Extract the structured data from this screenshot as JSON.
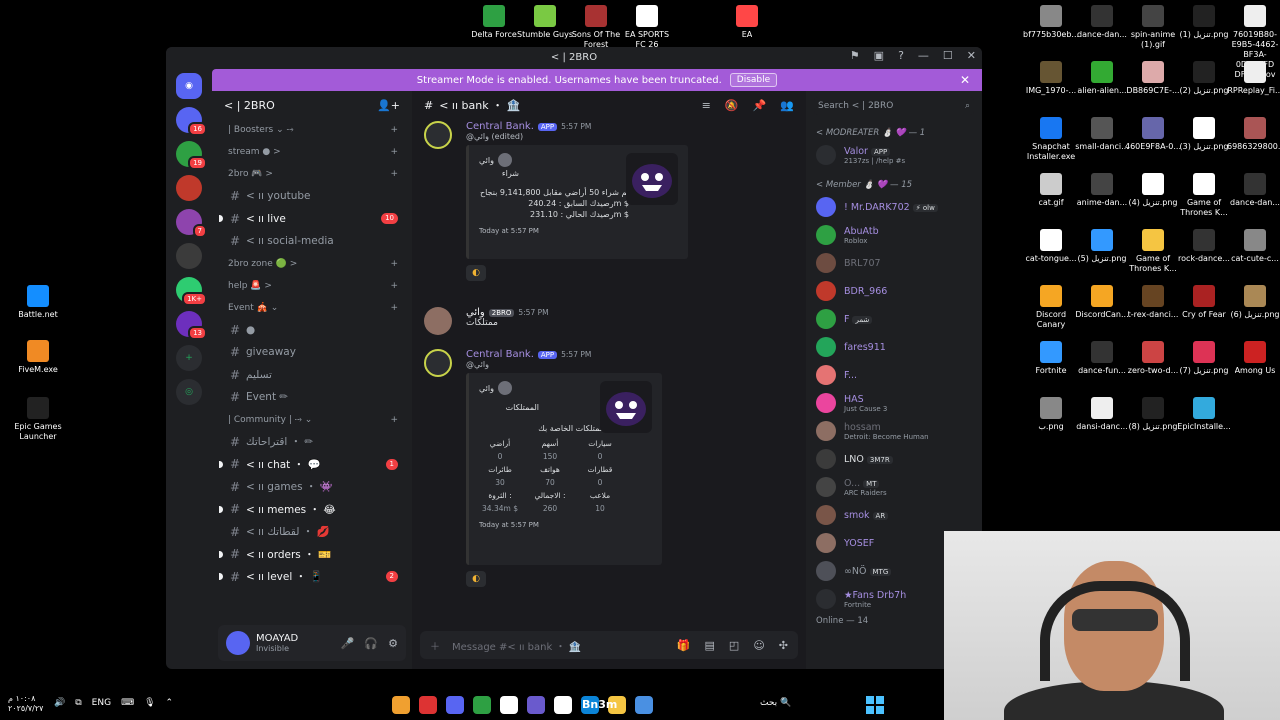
{
  "desktop": {
    "top_icons": [
      {
        "label": "Delta Force",
        "color": "#2ea043"
      },
      {
        "label": "Stumble Guys",
        "color": "#7ac943"
      },
      {
        "label": "Sons Of The Forest",
        "color": "#a83232"
      },
      {
        "label": "EA SPORTS FC 26",
        "color": "#ffffff"
      },
      {
        "label": "EA",
        "color": "#ff4747"
      }
    ],
    "left_icons": [
      {
        "label": "Battle.net",
        "color": "#148eff"
      },
      {
        "label": "FiveM.exe",
        "color": "#f08a24"
      },
      {
        "label": "Epic Games Launcher",
        "color": "#222222"
      }
    ],
    "right_icons": [
      {
        "label": "bf775b30eb...",
        "color": "#888888"
      },
      {
        "label": "dance-dan...",
        "color": "#333333"
      },
      {
        "label": "spin-anime (1).gif",
        "color": "#444444"
      },
      {
        "label": "تنزيل (1).png",
        "color": "#222222"
      },
      {
        "label": "76019B80-E9B5-4462-BF3A-0DD84FD DF85.mov",
        "color": "#eeeeee"
      },
      {
        "label": "IMG_1970-...",
        "color": "#665533"
      },
      {
        "label": "alien-alien...",
        "color": "#33aa33"
      },
      {
        "label": "DB869C7E-...",
        "color": "#ddaaaa"
      },
      {
        "label": "تنزيل (2).png",
        "color": "#222222"
      },
      {
        "label": "RPReplay_Fi...",
        "color": "#eeeeee"
      },
      {
        "label": "Snapchat Installer.exe",
        "color": "#1877f2"
      },
      {
        "label": "small-danci...",
        "color": "#555555"
      },
      {
        "label": "460E9F8A-0...",
        "color": "#6666aa"
      },
      {
        "label": "تنزيل (3).png",
        "color": "#ffffff"
      },
      {
        "label": "6986329800...",
        "color": "#aa5555"
      },
      {
        "label": "cat.gif",
        "color": "#cccccc"
      },
      {
        "label": "anime-dan...",
        "color": "#444444"
      },
      {
        "label": "تنزيل (4).png",
        "color": "#ffffff"
      },
      {
        "label": "Game of Thrones K...",
        "color": "#ffffff"
      },
      {
        "label": "dance-dan...",
        "color": "#333333"
      },
      {
        "label": "cat-tongue...",
        "color": "#ffffff"
      },
      {
        "label": "تنزيل (5).png",
        "color": "#3399ff"
      },
      {
        "label": "Game of Thrones K...",
        "color": "#f5c542"
      },
      {
        "label": "rock-dance...",
        "color": "#333333"
      },
      {
        "label": "cat-cute-c...",
        "color": "#888888"
      },
      {
        "label": "Discord Canary",
        "color": "#f5a623"
      },
      {
        "label": "DiscordCan...",
        "color": "#f5a623"
      },
      {
        "label": "t-rex-danci...",
        "color": "#664422"
      },
      {
        "label": "Cry of Fear",
        "color": "#aa2222"
      },
      {
        "label": "تنزيل (6).png",
        "color": "#aa8855"
      },
      {
        "label": "Fortnite",
        "color": "#3399ff"
      },
      {
        "label": "dance-fun...",
        "color": "#333333"
      },
      {
        "label": "zero-two-d...",
        "color": "#cc4444"
      },
      {
        "label": "تنزيل (7).png",
        "color": "#dd3355"
      },
      {
        "label": "Among Us",
        "color": "#cc2222"
      },
      {
        "label": "ب.png",
        "color": "#888888"
      },
      {
        "label": "dansi-danc...",
        "color": "#eeeeee"
      },
      {
        "label": "تنزيل (8).png",
        "color": "#222222"
      },
      {
        "label": "EpicInstalle...",
        "color": "#33aadd"
      }
    ]
  },
  "window": {
    "title": "< | 2BRO",
    "streamer_text": "Streamer Mode is enabled. Usernames have been truncated.",
    "disable_label": "Disable",
    "close_glyph": "✕"
  },
  "guilds": [
    {
      "color": "#5865f2",
      "badge": "16"
    },
    {
      "color": "#2ea043",
      "badge": "19"
    },
    {
      "color": "#c0392b",
      "badge": ""
    },
    {
      "color": "#8e44ad",
      "badge": "7"
    },
    {
      "color": "#3b3b3b",
      "badge": ""
    },
    {
      "color": "#2ecc71",
      "badge": "1K+"
    },
    {
      "color": "#6d2fbd",
      "badge": "13"
    }
  ],
  "server": {
    "name": "< | 2BRO"
  },
  "channels": [
    {
      "type": "cat",
      "label": "| Boosters ⌄ ⤑"
    },
    {
      "type": "cat",
      "label": "stream ● >"
    },
    {
      "type": "cat",
      "label": "2bro 🎮 >"
    },
    {
      "type": "ch",
      "label": "< ıı youtube",
      "unread": false,
      "count": ""
    },
    {
      "type": "ch",
      "label": "< ıı live",
      "unread": true,
      "count": "10"
    },
    {
      "type": "ch",
      "label": "< ıı social-media",
      "unread": false,
      "count": ""
    },
    {
      "type": "cat",
      "label": "2bro zone 🟢 >"
    },
    {
      "type": "cat",
      "label": "help 🚨 >"
    },
    {
      "type": "cat",
      "label": "Event 🎪 ⌄"
    },
    {
      "type": "ch",
      "label": "●",
      "unread": false,
      "count": ""
    },
    {
      "type": "ch",
      "label": "giveaway",
      "unread": false,
      "count": ""
    },
    {
      "type": "ch",
      "label": "تسليم",
      "unread": false,
      "count": ""
    },
    {
      "type": "ch",
      "label": "Event ✏",
      "unread": false,
      "count": ""
    },
    {
      "type": "cat",
      "label": "| Community | ⤑ ⌄"
    },
    {
      "type": "ch",
      "label": "اقتراحاتك ・ ✏",
      "unread": false,
      "count": ""
    },
    {
      "type": "ch",
      "label": "< ıı chat ・ 💬",
      "unread": true,
      "count": "1"
    },
    {
      "type": "ch",
      "label": "< ıı games ・ 👾",
      "unread": false,
      "count": ""
    },
    {
      "type": "ch",
      "label": "< ıı memes ・ 😂",
      "unread": true,
      "count": ""
    },
    {
      "type": "ch",
      "label": "< ıı لقطاتك ・ 💋",
      "unread": false,
      "count": ""
    },
    {
      "type": "ch",
      "label": "< ıı orders ・ 🎫",
      "unread": true,
      "count": ""
    },
    {
      "type": "ch",
      "label": "< ıı level ・ 📱",
      "unread": true,
      "count": "2"
    }
  ],
  "user": {
    "name": "MOAYAD",
    "status": "Invisible"
  },
  "chat": {
    "channel": "< ıı bank ・ 🏦",
    "composer_placeholder": "Message #< ıı bank ・ 🏦",
    "messages": {
      "m1": {
        "author": "Central Bank.",
        "app": "APP",
        "time": "5:57 PM",
        "reply": "@وائي (edited)",
        "embed_author": "وائي",
        "embed_title": "شراء",
        "line1": "تم شراء 50 أراضي مقابل 9,141,800 بنجاح",
        "line2": "رصيدك السابق : 240.24m $",
        "line3": "رصيدك الحالي : 231.10m $",
        "footer": "Today at 5:57 PM"
      },
      "m2": {
        "author": "وائي",
        "tag": "2BRO",
        "time": "5:57 PM",
        "text": "ممتلكات"
      },
      "m3": {
        "author": "Central Bank.",
        "app": "APP",
        "time": "5:57 PM",
        "reply": "@وائي",
        "embed_author": "وائي",
        "embed_title": "الممتلكات",
        "subtitle": "الممتلكات الخاصة بك",
        "grid": [
          [
            "أراضي",
            "أسهم",
            "سيارات"
          ],
          [
            "0",
            "150",
            "0"
          ],
          [
            "طائرات",
            "هواتف",
            "قطارات"
          ],
          [
            "30",
            "70",
            "0"
          ],
          [
            "الثروة :",
            "الاجمالي :",
            "ملاعب"
          ],
          [
            "34.34m $",
            "260",
            "10"
          ]
        ],
        "footer": "Today at 5:57 PM"
      }
    }
  },
  "members": {
    "search_placeholder": "Search < | 2BRO",
    "mod_header": "< MODREATER ⛄ 💜 — 1",
    "member_header": "< Member ⛄ 💜 — 15",
    "online_footer": "Online — 14",
    "mods": [
      {
        "name": "Valor",
        "sub": "2137zs | /help #s",
        "color": "#a58ee0",
        "av": "#2b2d31",
        "tag": "APP"
      }
    ],
    "list": [
      {
        "name": "! Mr.DARK702",
        "sub": "",
        "color": "#a58ee0",
        "av": "#5865f2",
        "tag": "⚡ olw"
      },
      {
        "name": "AbuAtb",
        "sub": "Roblox",
        "color": "#a58ee0",
        "av": "#2ea043",
        "tag": ""
      },
      {
        "name": "BRL707",
        "sub": "",
        "color": "#6d6f78",
        "av": "#6d4c41",
        "tag": ""
      },
      {
        "name": "BDR_966",
        "sub": "",
        "color": "#a58ee0",
        "av": "#c0392b",
        "tag": ""
      },
      {
        "name": "F",
        "sub": "",
        "color": "#a58ee0",
        "av": "#2ea043",
        "tag": "شمر"
      },
      {
        "name": "fares911",
        "sub": "",
        "color": "#a58ee0",
        "av": "#23a55a",
        "tag": ""
      },
      {
        "name": "F...",
        "sub": "",
        "color": "#a58ee0",
        "av": "#e57373",
        "tag": ""
      },
      {
        "name": "HAS",
        "sub": "Just Cause 3",
        "color": "#a58ee0",
        "av": "#eb459e",
        "tag": ""
      },
      {
        "name": "hossam",
        "sub": "Detroit: Become Human",
        "color": "#6d6f78",
        "av": "#8d6e63",
        "tag": ""
      },
      {
        "name": "LNO",
        "sub": "",
        "color": "#dbdee1",
        "av": "#3b3b3b",
        "tag": "3M7R"
      },
      {
        "name": "O...",
        "sub": "ARC Raiders",
        "color": "#6d6f78",
        "av": "#444444",
        "tag": "MT"
      },
      {
        "name": "smok",
        "sub": "",
        "color": "#a58ee0",
        "av": "#795548",
        "tag": "AR"
      },
      {
        "name": "YOSEF",
        "sub": "",
        "color": "#a58ee0",
        "av": "#8d6e63",
        "tag": ""
      },
      {
        "name": "∞NÖ",
        "sub": "",
        "color": "#949ba4",
        "av": "#4e5058",
        "tag": "MTG"
      },
      {
        "name": "★Fans Drb7h",
        "sub": "Fortnite",
        "color": "#a58ee0",
        "av": "#2b2d31",
        "tag": ""
      }
    ]
  },
  "taskbar": {
    "time": "١٠:٠٨ م",
    "date": "٢٠٢٥/٧/٢٧",
    "lang": "ENG",
    "search_text": "بحث",
    "overlay_text": "Bn3m"
  }
}
